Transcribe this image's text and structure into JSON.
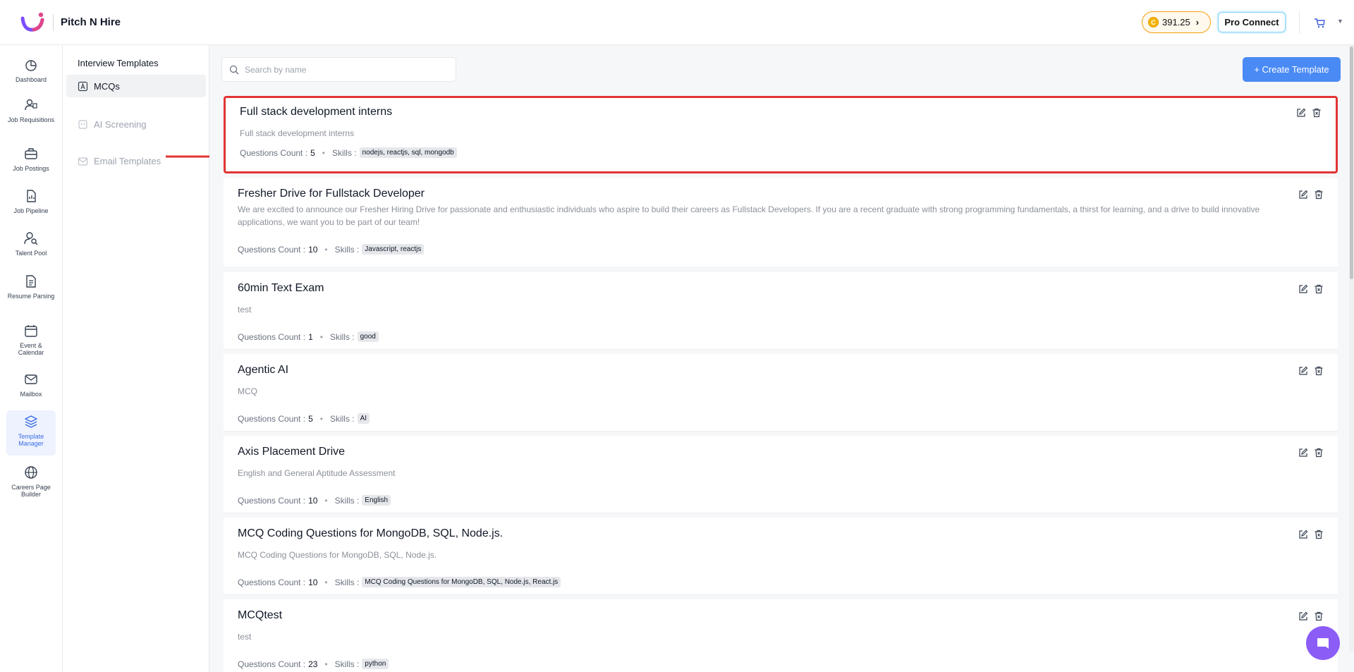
{
  "header": {
    "brand": "Pitch N Hire",
    "coins": "391.25",
    "pro_connect": "Pro Connect"
  },
  "rail": {
    "items": [
      {
        "label": "Dashboard",
        "icon": "dashboard-icon"
      },
      {
        "label": "Job Requisitions",
        "icon": "job-requisitions-icon"
      },
      {
        "label": "Job Postings",
        "icon": "briefcase-icon"
      },
      {
        "label": "Job Pipeline",
        "icon": "pipeline-icon"
      },
      {
        "label": "Talent Pool",
        "icon": "talent-icon"
      },
      {
        "label": "Resume Parsing",
        "icon": "resume-icon"
      },
      {
        "label": "Event & Calendar",
        "icon": "calendar-icon"
      },
      {
        "label": "Mailbox",
        "icon": "mail-icon"
      },
      {
        "label": "Template Manager",
        "icon": "layers-icon",
        "active": true
      },
      {
        "label": "Careers Page Builder",
        "icon": "globe-icon"
      }
    ]
  },
  "subnav": {
    "title": "Interview Templates",
    "items": [
      {
        "label": "MCQs",
        "active": true
      },
      {
        "label": "AI Screening"
      },
      {
        "label": "Email Templates"
      }
    ]
  },
  "toolbar": {
    "search_placeholder": "Search by name",
    "create_label": "+ Create Template"
  },
  "labels": {
    "questions_count": "Questions Count :",
    "skills": "Skills :",
    "separator": "•"
  },
  "templates": [
    {
      "title": "Full stack development interns",
      "description": "Full stack development interns",
      "count": "5",
      "skills": "nodejs, reactjs, sql, mongodb",
      "highlighted": true
    },
    {
      "title": "Fresher Drive for Fullstack Developer",
      "description": "We are excited to announce our Fresher Hiring Drive for passionate and enthusiastic individuals who aspire to build their careers as Fullstack Developers. If you are a recent graduate with strong programming fundamentals, a thirst for learning, and a drive to build innovative applications, we want you to be part of our team!",
      "count": "10",
      "skills": "Javascript, reactjs"
    },
    {
      "title": "60min Text Exam",
      "description": "test",
      "count": "1",
      "skills": "good"
    },
    {
      "title": "Agentic AI",
      "description": "MCQ",
      "count": "5",
      "skills": "AI"
    },
    {
      "title": "Axis Placement Drive",
      "description": "English and General Aptitude Assessment",
      "count": "10",
      "skills": "English"
    },
    {
      "title": "MCQ Coding Questions for MongoDB, SQL, Node.js.",
      "description": "MCQ Coding Questions for MongoDB, SQL, Node.js.",
      "count": "10",
      "skills": "MCQ Coding Questions for MongoDB, SQL, Node.js, React.js"
    },
    {
      "title": "MCQtest",
      "description": "test",
      "count": "23",
      "skills": "python"
    }
  ]
}
